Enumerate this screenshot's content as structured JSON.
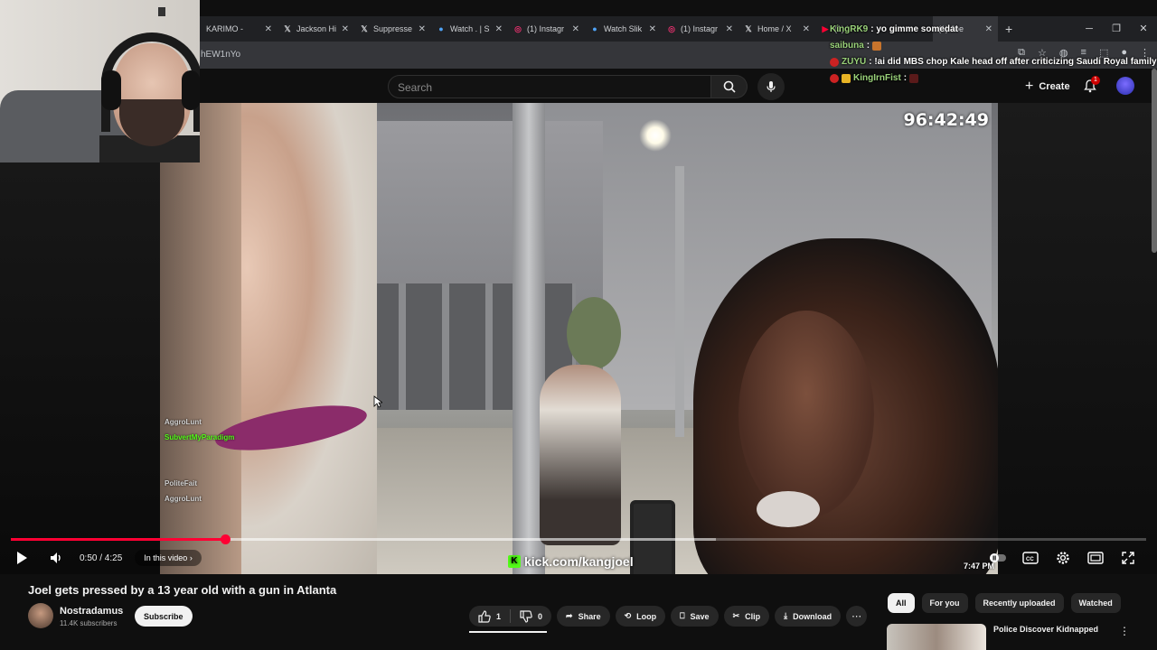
{
  "browser": {
    "tabs": [
      {
        "title": "KARIMO -",
        "icon": "kick-icon"
      },
      {
        "title": "Jackson Hi",
        "icon": "x-icon"
      },
      {
        "title": "Suppresse",
        "icon": "x-icon"
      },
      {
        "title": "Watch . | S",
        "icon": "globe-icon"
      },
      {
        "title": "(1) Instagr",
        "icon": "instagram-icon"
      },
      {
        "title": "Watch Slik",
        "icon": "globe-icon"
      },
      {
        "title": "(1) Instagr",
        "icon": "instagram-icon"
      },
      {
        "title": "Home / X",
        "icon": "x-icon"
      },
      {
        "title": "(1) '",
        "icon": "youtube-icon"
      },
      {
        "title": "(1) Joe",
        "icon": "youtube-icon"
      }
    ],
    "url": "hEW1nYo"
  },
  "stream_chat": [
    {
      "user": "KingRK9",
      "message": ": yo gimme somedat",
      "color": "#9ad27a"
    },
    {
      "user": "saibuna",
      "message": ":",
      "color": "#9ad27a"
    },
    {
      "user": "ZUYU",
      "message": ": !ai did MBS chop Kale head off after criticizing Saudi Royal family?",
      "color": "#9ad27a"
    },
    {
      "user": "KingIrnFist",
      "message": ":",
      "color": "#9ad27a"
    }
  ],
  "masthead": {
    "search_placeholder": "Search",
    "create_label": "Create",
    "notification_count": "1"
  },
  "video": {
    "stream_timer": "96:42:49",
    "watermark": "kick.com/kangjoel",
    "clock": "7:47 PM",
    "embedded_chat": [
      "AggroLunt",
      "SubvertMyParadigm",
      "PoliteFait",
      "AggroLunt"
    ],
    "time_display": "0:50 / 4:25",
    "chapter_chip": "In this video",
    "progress_fraction": 0.189
  },
  "info": {
    "title": "Joel gets pressed by a 13 year old with a gun in Atlanta",
    "channel": "Nostradamus",
    "subscribers": "11.4K subscribers",
    "subscribe_label": "Subscribe",
    "likes": "1",
    "dislikes": "0",
    "share": "Share",
    "loop": "Loop",
    "save": "Save",
    "clip": "Clip",
    "download": "Download"
  },
  "recommendations": {
    "chips": [
      "All",
      "For you",
      "Recently uploaded",
      "Watched"
    ],
    "first_title": "Police Discover Kidnapped"
  }
}
